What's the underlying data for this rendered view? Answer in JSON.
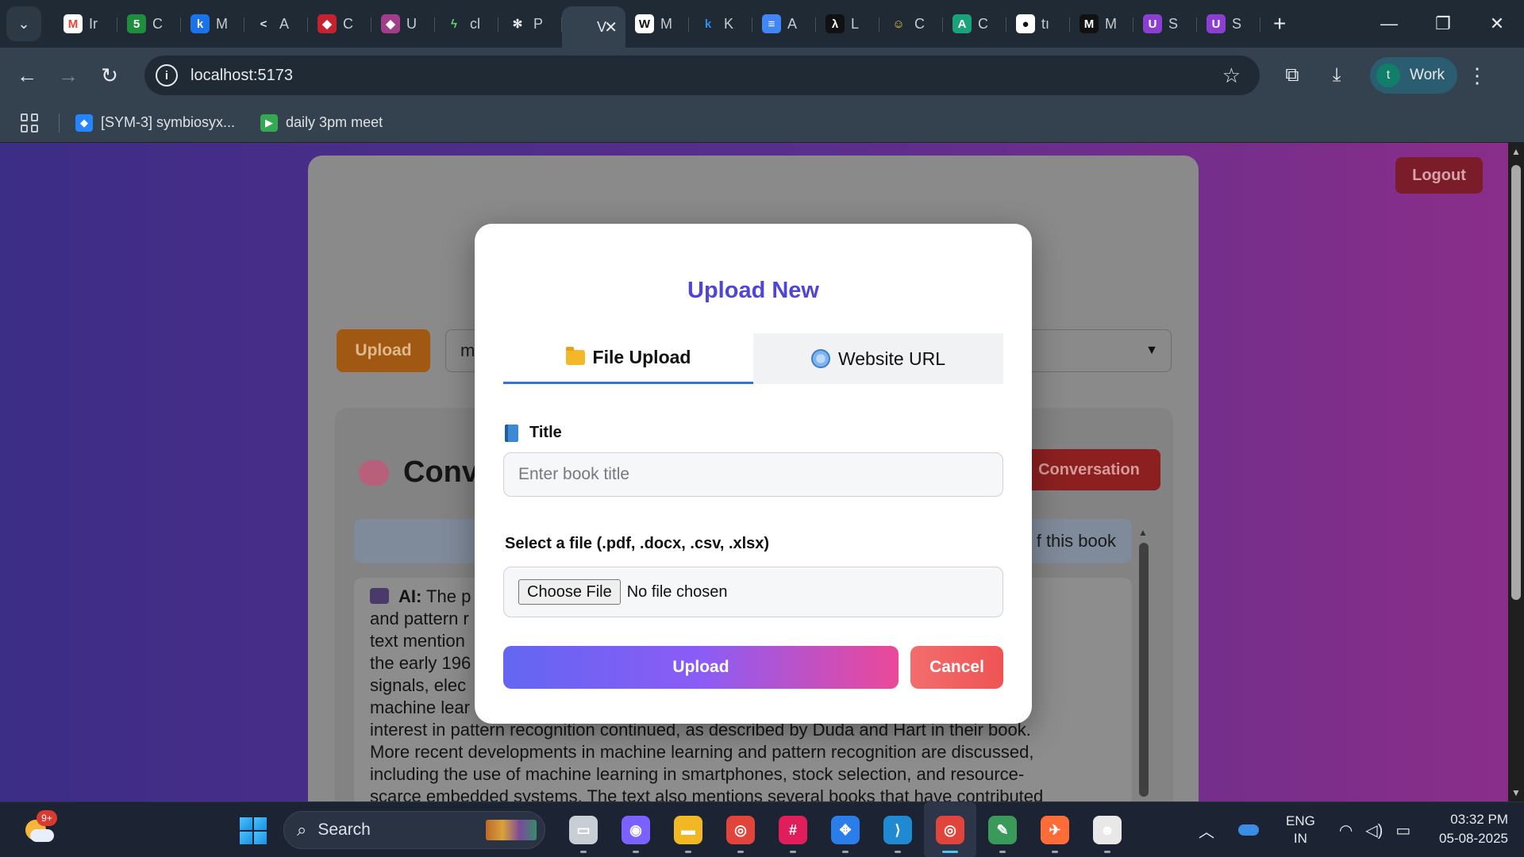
{
  "browser": {
    "tabs": [
      {
        "letter": "Ir",
        "icon": "gmail-icon",
        "color": "#ffffff",
        "glyph": "M",
        "glyphColor": "#ea4335"
      },
      {
        "letter": "C",
        "icon": "calendar-icon",
        "color": "#1e8e3e",
        "glyph": "5",
        "glyphColor": "#ffffff"
      },
      {
        "letter": "M",
        "icon": "k-icon",
        "color": "#1a73e8",
        "glyph": "k",
        "glyphColor": "#ffffff"
      },
      {
        "letter": "A",
        "icon": "share-icon",
        "color": "transparent",
        "glyph": "<",
        "glyphColor": "#dfe2e5"
      },
      {
        "letter": "C",
        "icon": "hexagon-icon",
        "color": "#c5222f",
        "glyph": "◆",
        "glyphColor": "#ffffff"
      },
      {
        "letter": "U",
        "icon": "hexagon-icon",
        "color": "#a23d8a",
        "glyph": "◆",
        "glyphColor": "#ffffff"
      },
      {
        "letter": "cl",
        "icon": "bolt-icon",
        "color": "transparent",
        "glyph": "ϟ",
        "glyphColor": "#5ad46a"
      },
      {
        "letter": "P",
        "icon": "openai-icon",
        "color": "transparent",
        "glyph": "✻",
        "glyphColor": "#e8eaed"
      },
      {
        "letter": "V",
        "icon": "page-icon",
        "color": "transparent",
        "glyph": "",
        "glyphColor": "#e8eaed",
        "active": true
      },
      {
        "letter": "M",
        "icon": "wikipedia-icon",
        "color": "#ffffff",
        "glyph": "W",
        "glyphColor": "#111111"
      },
      {
        "letter": "K",
        "icon": "k-icon",
        "color": "transparent",
        "glyph": "k",
        "glyphColor": "#2f8fe8"
      },
      {
        "letter": "A",
        "icon": "docs-icon",
        "color": "#4285f4",
        "glyph": "≡",
        "glyphColor": "#ffffff"
      },
      {
        "letter": "L",
        "icon": "lambda-icon",
        "color": "#111111",
        "glyph": "λ",
        "glyphColor": "#ffffff"
      },
      {
        "letter": "C",
        "icon": "hugging-face-icon",
        "color": "transparent",
        "glyph": "☺",
        "glyphColor": "#f5c842"
      },
      {
        "letter": "C",
        "icon": "vector-icon",
        "color": "#1aa37a",
        "glyph": "A",
        "glyphColor": "#ffffff"
      },
      {
        "letter": "tı",
        "icon": "github-icon",
        "color": "#ffffff",
        "glyph": "●",
        "glyphColor": "#111111"
      },
      {
        "letter": "M",
        "icon": "medium-icon",
        "color": "#111111",
        "glyph": "M",
        "glyphColor": "#ffffff"
      },
      {
        "letter": "S",
        "icon": "u-badge-icon",
        "color": "#8a3fd1",
        "glyph": "U",
        "glyphColor": "#ffffff"
      },
      {
        "letter": "S",
        "icon": "u-badge-icon",
        "color": "#8a3fd1",
        "glyph": "U",
        "glyphColor": "#ffffff"
      }
    ],
    "url": "localhost:5173",
    "profile_initial": "t",
    "profile_label": "Work",
    "bookmarks": [
      {
        "label": "[SYM-3] symbiosyx...",
        "icon": "jira-icon",
        "color": "#2684ff"
      },
      {
        "label": "daily 3pm meet",
        "icon": "meet-icon",
        "color": "#34a853"
      }
    ]
  },
  "page": {
    "logout_label": "Logout",
    "upload_label": "Upload",
    "select_value": "m",
    "conversation_title": "Conv",
    "new_conversation_label": "Conversation",
    "suggestion_text": "f this book",
    "chat_prefix": "AI:",
    "chat_lines": [
      "The p                                                                                              arning",
      "and pattern r                                                                                       d. The",
      "text mention                                                                                      ertron in",
      "the early 196                                                                                    ing sonar",
      "signals, elec                                                                                     h into",
      "machine lear                                                                                       1970s,",
      "interest in pattern recognition continued, as described by Duda and Hart in their book.",
      "More recent developments in machine learning and pattern recognition are discussed,",
      "including the use of machine learning in smartphones, stock selection, and resource-",
      "scarce embedded systems. The text also mentions several books that have contributed"
    ]
  },
  "modal": {
    "title": "Upload New",
    "tab_file": "File Upload",
    "tab_url": "Website URL",
    "title_label": "Title",
    "title_placeholder": "Enter book title",
    "file_label": "Select a file (.pdf, .docx, .csv, .xlsx)",
    "choose_file_label": "Choose File",
    "no_file_text": "No file chosen",
    "upload_label": "Upload",
    "cancel_label": "Cancel"
  },
  "taskbar": {
    "weather_badge": "9+",
    "search_label": "Search",
    "apps": [
      {
        "name": "task-view-icon",
        "color": "#c9ced6",
        "glyph": "▭"
      },
      {
        "name": "copilot-icon",
        "color": "#7b61ff",
        "glyph": "◉"
      },
      {
        "name": "file-explorer-icon",
        "color": "#f2b824",
        "glyph": "▬"
      },
      {
        "name": "chrome-icon",
        "color": "#e0443a",
        "glyph": "◎"
      },
      {
        "name": "slack-icon",
        "color": "#e01e5a",
        "glyph": "#"
      },
      {
        "name": "network-app-icon",
        "color": "#2b7de9",
        "glyph": "✥"
      },
      {
        "name": "vscode-icon",
        "color": "#1f8ad2",
        "glyph": "⟩"
      },
      {
        "name": "chrome-profile-icon",
        "color": "#e0443a",
        "glyph": "◎",
        "active": true
      },
      {
        "name": "notepad-icon",
        "color": "#3a9a5a",
        "glyph": "✎"
      },
      {
        "name": "postman-icon",
        "color": "#ff6c37",
        "glyph": "✈"
      },
      {
        "name": "linux-app-icon",
        "color": "#e8e8e8",
        "glyph": "☻"
      }
    ],
    "lang_line1": "ENG",
    "lang_line2": "IN",
    "time": "03:32 PM",
    "date": "05-08-2025"
  }
}
